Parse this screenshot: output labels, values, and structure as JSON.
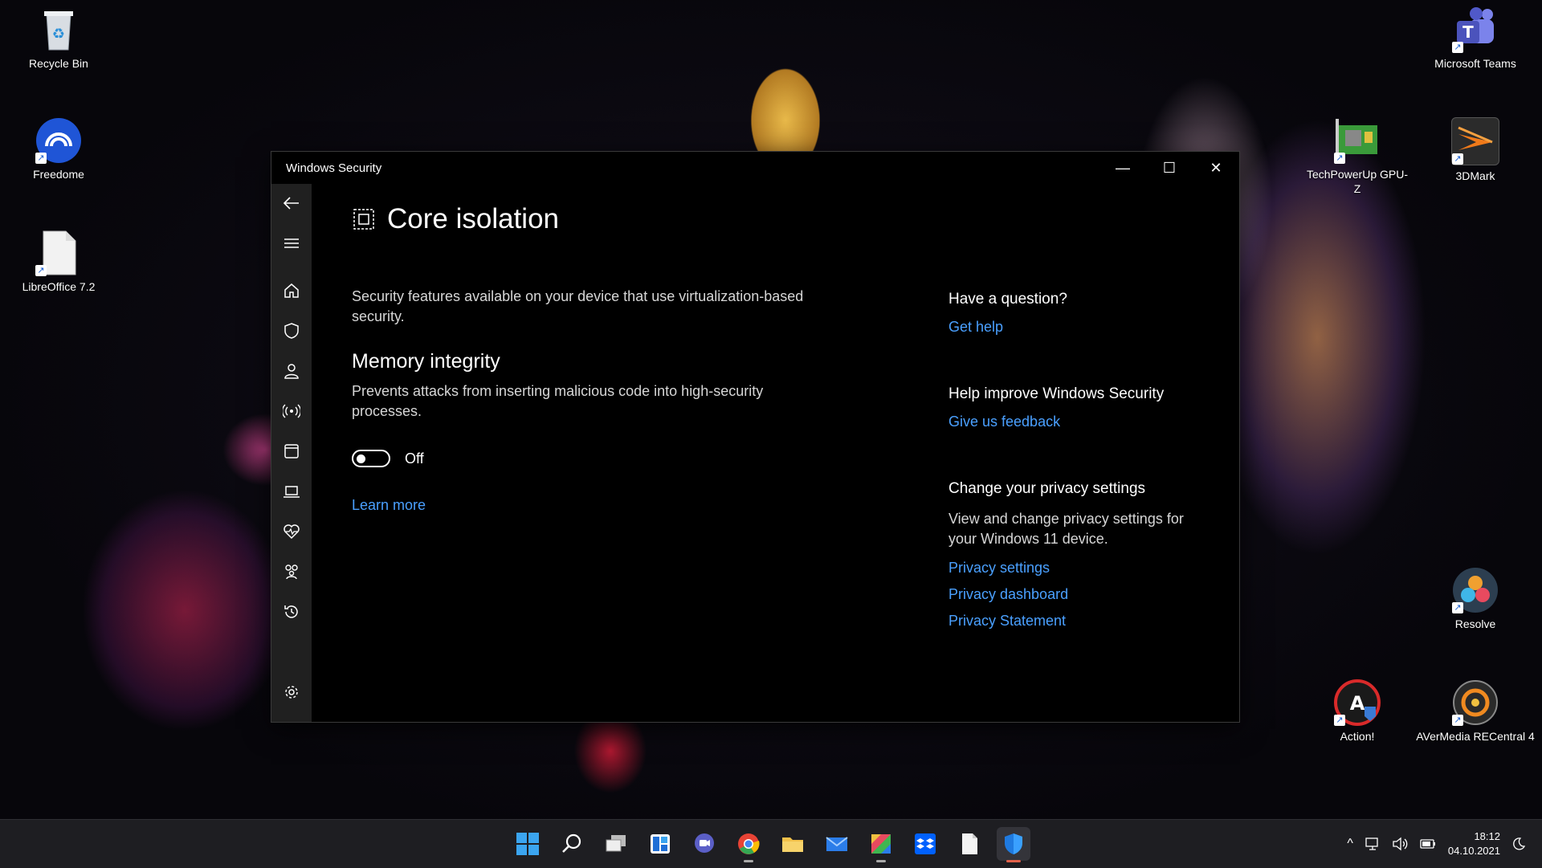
{
  "desktop": {
    "icons": [
      {
        "label": "Recycle Bin"
      },
      {
        "label": "Freedome"
      },
      {
        "label": "LibreOffice 7.2"
      },
      {
        "label": "Microsoft Teams"
      },
      {
        "label": "TechPowerUp GPU-Z"
      },
      {
        "label": "3DMark"
      },
      {
        "label": "Resolve"
      },
      {
        "label": "Action!"
      },
      {
        "label": "AVerMedia RECentral 4"
      }
    ]
  },
  "window": {
    "title": "Windows Security",
    "controls": {
      "minimize": "—",
      "maximize": "☐",
      "close": "✕"
    }
  },
  "sidebar": {
    "items": [
      {
        "icon": "back-arrow-icon"
      },
      {
        "icon": "hamburger-menu-icon"
      },
      {
        "icon": "home-icon"
      },
      {
        "icon": "shield-icon"
      },
      {
        "icon": "person-icon"
      },
      {
        "icon": "antenna-icon"
      },
      {
        "icon": "app-browser-icon"
      },
      {
        "icon": "laptop-icon"
      },
      {
        "icon": "heart-pulse-icon"
      },
      {
        "icon": "family-icon"
      },
      {
        "icon": "history-icon"
      },
      {
        "icon": "gear-icon"
      }
    ]
  },
  "main": {
    "title": "Core isolation",
    "description": "Security features available on your device that use virtualization-based security.",
    "section": {
      "heading": "Memory integrity",
      "description": "Prevents attacks from inserting malicious code into high-security processes.",
      "toggle_state": "Off",
      "learn_more": "Learn more"
    }
  },
  "side": {
    "question_heading": "Have a question?",
    "get_help": "Get help",
    "improve_heading": "Help improve Windows Security",
    "feedback": "Give us feedback",
    "privacy_heading": "Change your privacy settings",
    "privacy_text": "View and change privacy settings for your Windows 11 device.",
    "privacy_settings": "Privacy settings",
    "privacy_dashboard": "Privacy dashboard",
    "privacy_statement": "Privacy Statement"
  },
  "taskbar": {
    "apps": [
      "start-icon",
      "search-icon",
      "task-view-icon",
      "widgets-icon",
      "chat-icon",
      "chrome-icon",
      "file-explorer-icon",
      "mail-icon",
      "color-app-icon",
      "dropbox-icon",
      "document-icon",
      "windows-security-icon"
    ],
    "tray": {
      "chevron": "^",
      "time": "18:12",
      "date": "04.10.2021"
    }
  },
  "colors": {
    "link": "#4aa0ff",
    "sidebar": "#202020",
    "window_bg": "#000000",
    "taskbar": "#1e1e22"
  }
}
